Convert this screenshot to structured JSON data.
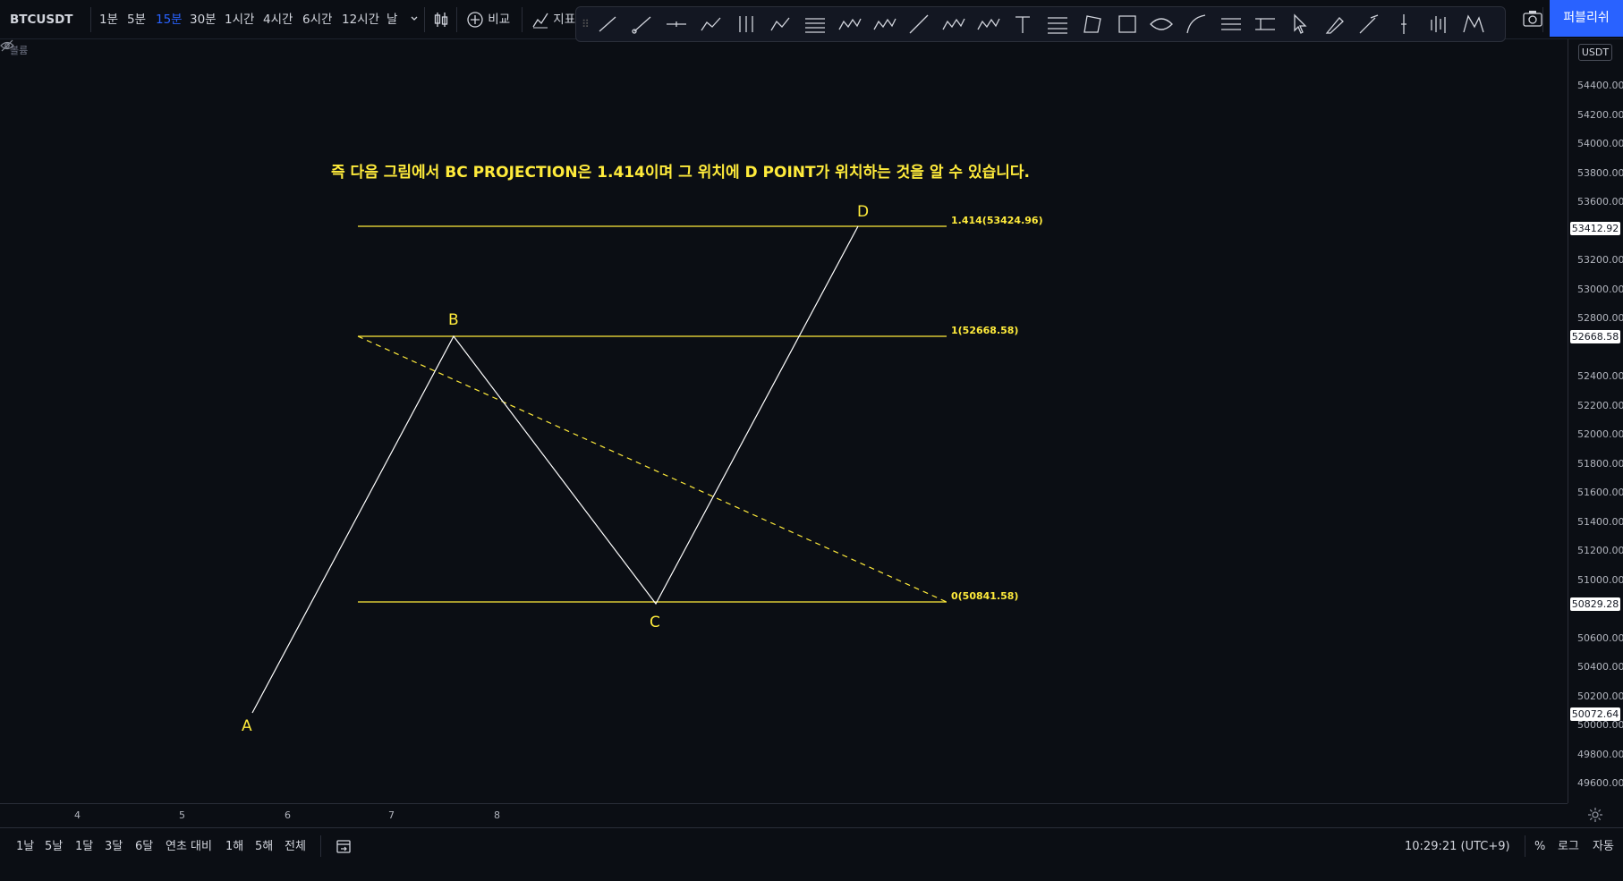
{
  "toolbar": {
    "symbol": "BTCUSDT",
    "intervals": [
      "1분",
      "5분",
      "15분",
      "30분",
      "1시간",
      "4시간",
      "6시간",
      "12시간",
      "날"
    ],
    "active_interval": "15분",
    "compare_label": "비교",
    "indicators_label": "지표",
    "publish_label": "퍼블리쉬"
  },
  "chart": {
    "volume_label": "볼륨",
    "caption": "즉 다음 그림에서 BC PROJECTION은 1.414이며 그 위치에 D POINT가 위치하는 것을 알 수 있습니다.",
    "points": {
      "a": "A",
      "b": "B",
      "c": "C",
      "d": "D"
    },
    "levels": {
      "l1414": "1.414(53424.96)",
      "l1": "1(52668.58)",
      "l0": "0(50841.58)"
    },
    "accent_color": "#ffeb3b"
  },
  "price_axis": {
    "unit": "USDT",
    "ticks": [
      "54400.00",
      "54200.00",
      "54000.00",
      "53800.00",
      "53600.00",
      "53200.00",
      "53000.00",
      "52800.00",
      "52400.00",
      "52200.00",
      "52000.00",
      "51800.00",
      "51600.00",
      "51400.00",
      "51200.00",
      "51000.00",
      "50600.00",
      "50400.00",
      "50200.00",
      "50000.00",
      "49800.00",
      "49600.00"
    ],
    "labels": [
      "53412.92",
      "52668.58",
      "50829.28",
      "50072.64"
    ]
  },
  "time_axis": {
    "ticks": [
      "4",
      "5",
      "6",
      "7",
      "8"
    ]
  },
  "bottom": {
    "ranges": [
      "1날",
      "5날",
      "1달",
      "3달",
      "6달",
      "연초 대비",
      "1해",
      "5해",
      "전체"
    ],
    "time": "10:29:21 (UTC+9)",
    "percent": "%",
    "log": "로그",
    "auto": "자동"
  }
}
